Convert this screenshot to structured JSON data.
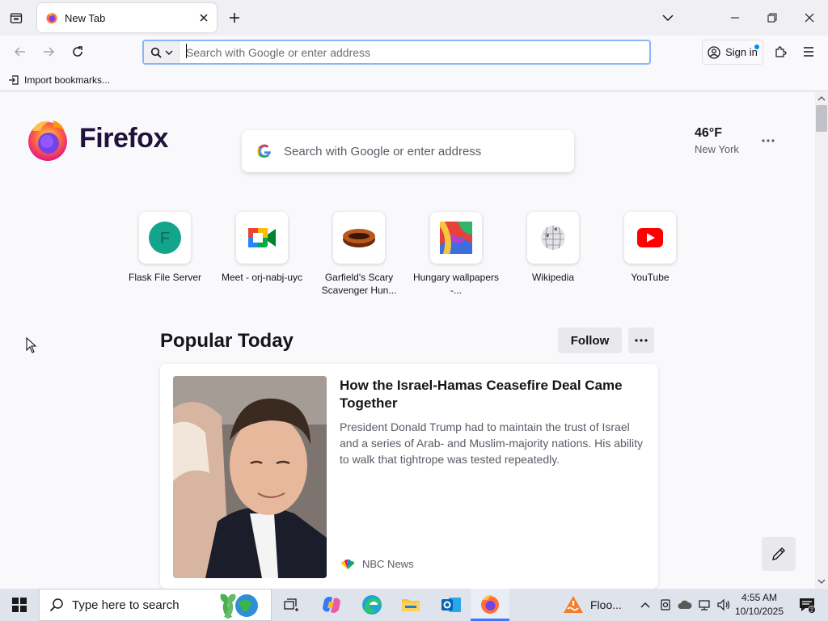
{
  "tab": {
    "title": "New Tab"
  },
  "navbar": {
    "url_placeholder": "Search with Google or enter address",
    "signin_label": "Sign in"
  },
  "bookmarks": {
    "import_label": "Import bookmarks..."
  },
  "newtab": {
    "brand": "Firefox",
    "search_placeholder": "Search with Google or enter address",
    "weather": {
      "temp": "46°F",
      "city": "New York"
    },
    "shortcuts": [
      {
        "label": "Flask File Server",
        "icon": "letter-f-icon",
        "letter": "F"
      },
      {
        "label": "Meet - orj-nabj-uyc",
        "icon": "google-meet-icon"
      },
      {
        "label": "Garfield's Scary Scavenger Hun...",
        "icon": "garfield-game-icon"
      },
      {
        "label": "Hungary wallpapers -...",
        "icon": "colorful-wallpaper-icon"
      },
      {
        "label": "Wikipedia",
        "icon": "wikipedia-globe-icon"
      },
      {
        "label": "YouTube",
        "icon": "youtube-icon"
      }
    ],
    "popular": {
      "title": "Popular Today",
      "follow_label": "Follow",
      "story": {
        "headline": "How the Israel-Hamas Ceasefire Deal Came Together",
        "excerpt": "President Donald Trump had to maintain the trust of Israel and a series of Arab- and Muslim-majority nations. His ability to walk that tightrope was tested repeatedly.",
        "source": "NBC News"
      }
    }
  },
  "taskbar": {
    "search_placeholder": "Type here to search",
    "weather_label": "Floo...",
    "time": "4:55 AM",
    "date": "10/10/2025",
    "notification_count": "2"
  },
  "colors": {
    "accent": "#0061e0",
    "focus_ring": "#8ab4f8",
    "firefox_orange": "#ff7139",
    "youtube_red": "#ff0000",
    "taskbar_bg": "#dfe3eb"
  }
}
